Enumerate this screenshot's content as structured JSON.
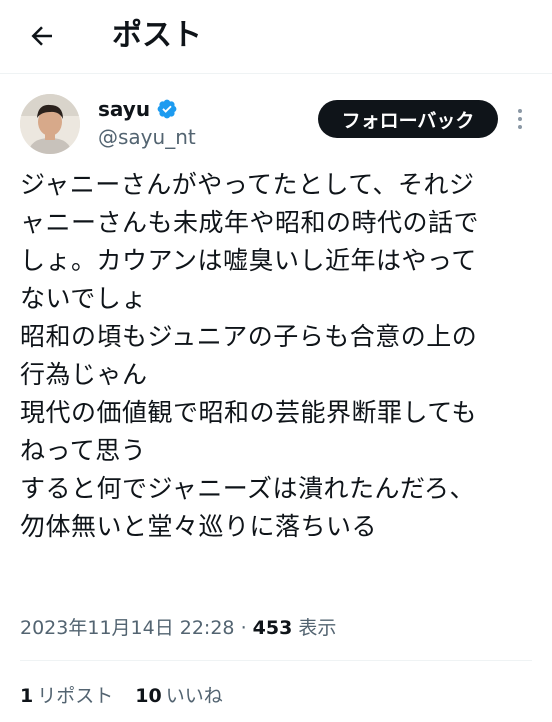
{
  "header": {
    "title": "ポスト",
    "back_icon": "arrow-left-icon"
  },
  "author": {
    "display_name": "sayu",
    "handle": "@sayu_nt",
    "verified_icon": "verified-badge-icon",
    "verified_color": "#1d9bf0",
    "follow_label": "フォローバック",
    "more_icon": "more-vertical-icon"
  },
  "tweet": {
    "lines": [
      "ジャニーさんがやってたとして、それジ",
      "ャニーさんも未成年や昭和の時代の話で",
      "しょ。カウアンは嘘臭いし近年はやって",
      "ないでしょ",
      "昭和の頃もジュニアの子らも合意の上の",
      "行為じゃん",
      "現代の価値観で昭和の芸能界断罪しても",
      "ねって思う",
      "すると何でジャニーズは潰れたんだろ、",
      "勿体無いと堂々巡りに落ちいる"
    ]
  },
  "meta": {
    "timestamp": "2023年11月14日 22:28",
    "separator": "·",
    "views_count": "453",
    "views_label": "表示"
  },
  "stats": {
    "reposts_count": "1",
    "reposts_label": "リポスト",
    "likes_count": "10",
    "likes_label": "いいね"
  }
}
